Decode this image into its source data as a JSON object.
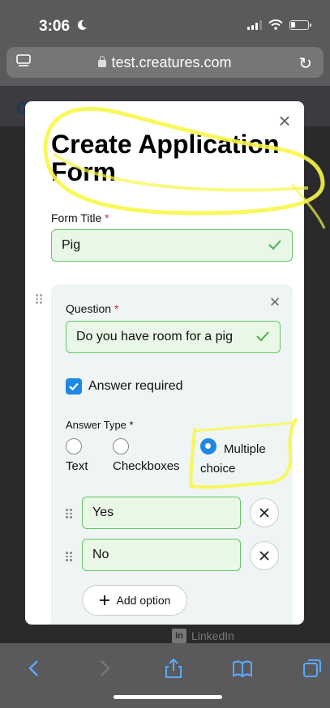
{
  "status_bar": {
    "time": "3:06",
    "moon_icon": "moon-icon"
  },
  "browser": {
    "url": "test.creatures.com"
  },
  "background_page": {
    "logo": "creatures",
    "footer_link": "LinkedIn"
  },
  "modal": {
    "title": "Create Application Form",
    "form_title_label": "Form Title",
    "required_mark": "*",
    "form_title_value": "Pig",
    "question": {
      "label": "Question",
      "required_mark": "*",
      "value": "Do you have room for a pig",
      "answer_required_label": "Answer required",
      "answer_required_checked": true,
      "answer_type_label": "Answer Type *",
      "answer_types": [
        {
          "label": "Text",
          "selected": false
        },
        {
          "label": "Checkboxes",
          "selected": false
        },
        {
          "label": "Multiple choice",
          "selected": true
        }
      ],
      "options": [
        {
          "value": "Yes"
        },
        {
          "value": "No"
        }
      ],
      "add_option_label": "Add option"
    }
  },
  "colors": {
    "accent": "#1e88e5",
    "field_valid_bg": "#e9f7e6",
    "field_valid_border": "#66c46a",
    "highlighter": "#f7f74a"
  }
}
